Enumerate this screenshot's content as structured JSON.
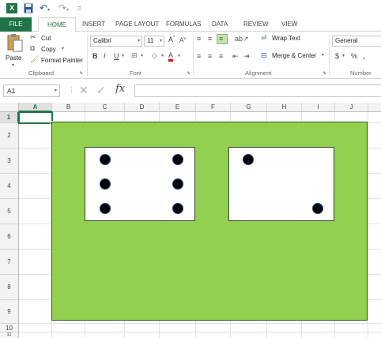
{
  "app": {
    "logo_text": "X",
    "qat_more": "="
  },
  "tabs": [
    {
      "label": "FILE"
    },
    {
      "label": "HOME"
    },
    {
      "label": "INSERT"
    },
    {
      "label": "PAGE LAYOUT"
    },
    {
      "label": "FORMULAS"
    },
    {
      "label": "DATA"
    },
    {
      "label": "REVIEW"
    },
    {
      "label": "VIEW"
    }
  ],
  "ribbon": {
    "clipboard": {
      "paste": "Paste",
      "cut": "Cut",
      "copy": "Copy",
      "format_painter": "Format Painter",
      "label": "Clipboard"
    },
    "font": {
      "name": "Calibri",
      "size": "11",
      "bold": "B",
      "italic": "I",
      "underline": "U",
      "grow": "A",
      "shrink": "A",
      "font_color": "A",
      "label": "Font"
    },
    "alignment": {
      "wrap_text": "Wrap Text",
      "merge_center": "Merge & Center",
      "label": "Alignment"
    },
    "number": {
      "format": "General",
      "currency": "$",
      "percent": "%",
      "comma": ",",
      "label": "Number"
    }
  },
  "formula_bar": {
    "name_box": "A1",
    "cancel": "✕",
    "enter": "✓",
    "fx": "fx",
    "content": ""
  },
  "sheet": {
    "columns": [
      "A",
      "B",
      "C",
      "D",
      "E",
      "F",
      "G",
      "H",
      "I",
      "J"
    ],
    "rows": [
      "1",
      "2",
      "3",
      "4",
      "5",
      "6",
      "7",
      "8",
      "9",
      "10",
      "11"
    ],
    "selected_column": "A",
    "selected_row": "1"
  },
  "colors": {
    "accent": "#217346",
    "green_fill": "#92d050",
    "die_fill": "#ffffff",
    "pip": "#000000"
  },
  "dice": [
    {
      "name": "die-left",
      "value": 6
    },
    {
      "name": "die-right",
      "value": 2
    }
  ]
}
